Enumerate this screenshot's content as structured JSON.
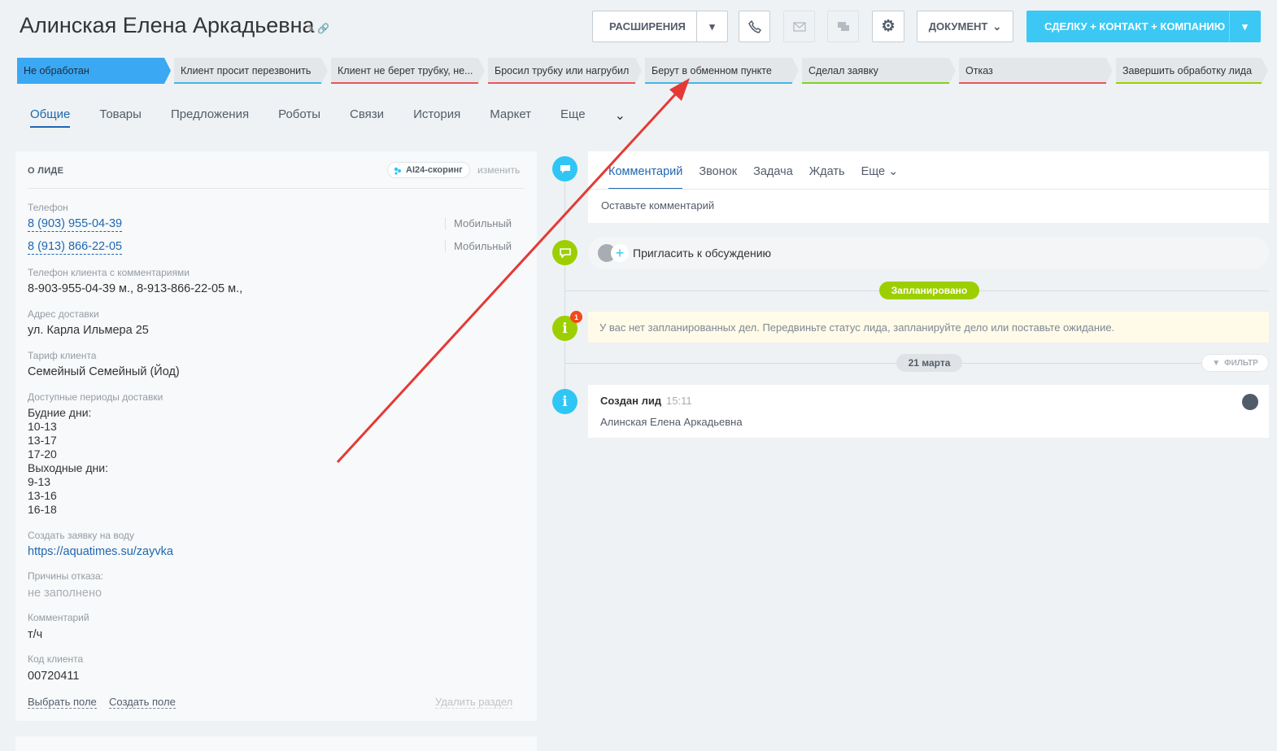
{
  "header": {
    "title": "Алинская Елена  Аркадьевна",
    "extensions_label": "РАСШИРЕНИЯ",
    "document_label": "ДОКУМЕНТ",
    "convert_label": "СДЕЛКУ + КОНТАКТ + КОМПАНИЮ"
  },
  "stages": [
    {
      "label": "Не обработан",
      "color": "#3ba8f3",
      "active": true
    },
    {
      "label": "Клиент просит перезвонить",
      "color": "#47b6e8"
    },
    {
      "label": "Клиент не берет трубку, не...",
      "color": "#e8555a"
    },
    {
      "label": "Бросил трубку или нагрубил",
      "color": "#e8555a"
    },
    {
      "label": "Берут в обменном пункте",
      "color": "#47b6e8"
    },
    {
      "label": "Сделал заявку",
      "color": "#7ed321"
    },
    {
      "label": "Отказ",
      "color": "#e8555a"
    },
    {
      "label": "Завершить обработку лида",
      "color": "#9dcf00"
    }
  ],
  "tabs": [
    "Общие",
    "Товары",
    "Предложения",
    "Роботы",
    "Связи",
    "История",
    "Маркет",
    "Еще"
  ],
  "lead": {
    "section_title": "О ЛИДЕ",
    "ai_label": "AI24-скоринг",
    "edit_label": "изменить",
    "phone_label": "Телефон",
    "phones": [
      {
        "number": "8 (903) 955-04-39",
        "type": "Мобильный"
      },
      {
        "number": "8 (913) 866-22-05",
        "type": "Мобильный"
      }
    ],
    "phone_comment_label": "Телефон клиента с комментариями",
    "phone_comment": "8-903-955-04-39 м., 8-913-866-22-05 м.,",
    "address_label": "Адрес доставки",
    "address": "ул. Карла Ильмера 25",
    "tariff_label": "Тариф клиента",
    "tariff": "Семейный Семейный (Йод)",
    "periods_label": "Доступные периоды доставки",
    "periods": [
      "Будние дни:",
      "10-13",
      "13-17",
      "17-20",
      "Выходные дни:",
      "9-13",
      "13-16",
      "16-18"
    ],
    "order_label": "Создать заявку на воду",
    "order_link": "https://aquatimes.su/zayvka",
    "reject_label": "Причины отказа:",
    "reject_value": "не заполнено",
    "comment_label": "Комментарий",
    "comment_value": "т/ч",
    "code_label": "Код клиента",
    "code_value": "00720411",
    "choose_field": "Выбрать поле",
    "create_field": "Создать поле",
    "delete_section": "Удалить раздел"
  },
  "timeline": {
    "cmt_tabs": [
      "Комментарий",
      "Звонок",
      "Задача",
      "Ждать",
      "Еще"
    ],
    "cmt_placeholder": "Оставьте комментарий",
    "invite": "Пригласить к обсуждению",
    "planned": "Запланировано",
    "warn_count": "1",
    "warn_text": "У вас нет запланированных дел. Передвиньте статус лида, запланируйте дело или поставьте ожидание.",
    "date": "21 марта",
    "filter": "ФИЛЬТР",
    "created_title": "Создан лид",
    "created_time": "15:11",
    "created_name": "Алинская Елена Аркадьевна"
  },
  "colors": {
    "accent": "#3bc8f5",
    "link": "#2067b0",
    "arrow": "#e53935"
  }
}
